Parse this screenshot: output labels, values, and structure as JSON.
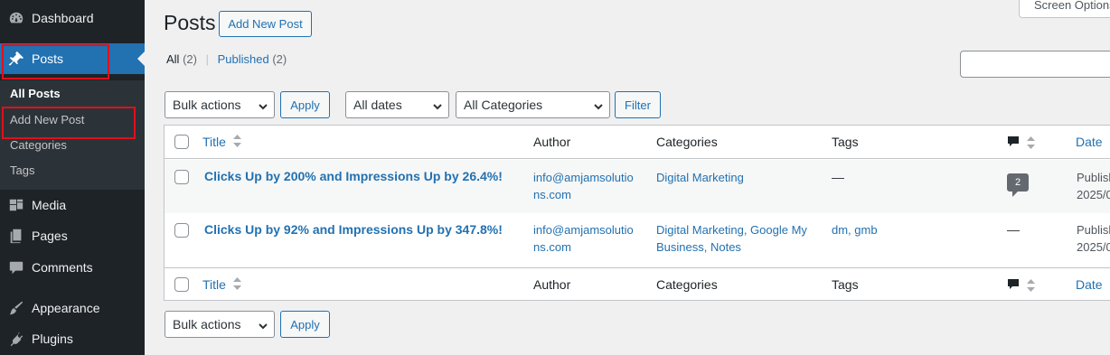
{
  "sidebar": {
    "items": [
      {
        "label": "Dashboard",
        "icon": "dashboard-icon"
      },
      {
        "label": "Posts",
        "icon": "pushpin-icon"
      },
      {
        "label": "Media",
        "icon": "media-icon"
      },
      {
        "label": "Pages",
        "icon": "pages-icon"
      },
      {
        "label": "Comments",
        "icon": "comments-icon"
      },
      {
        "label": "Appearance",
        "icon": "appearance-icon"
      },
      {
        "label": "Plugins",
        "icon": "plugins-icon"
      }
    ],
    "submenu": [
      "All Posts",
      "Add New Post",
      "Categories",
      "Tags"
    ]
  },
  "header": {
    "title": "Posts",
    "add_new_label": "Add New Post",
    "screen_options": "Screen Options"
  },
  "views": {
    "all_label": "All",
    "all_count": "(2)",
    "separator": "|",
    "published_label": "Published",
    "published_count": "(2)"
  },
  "filters": {
    "bulk_actions": "Bulk actions",
    "apply": "Apply",
    "dates": "All dates",
    "categories": "All Categories",
    "filter": "Filter"
  },
  "table": {
    "columns": {
      "title": "Title",
      "author": "Author",
      "categories": "Categories",
      "tags": "Tags",
      "date": "Date"
    },
    "rows": [
      {
        "title": "Clicks Up by 200% and Impressions Up by 26.4%!",
        "author_line1": "info@amjamsolutio",
        "author_line2": "ns.com",
        "categories_line1": "Digital Marketing",
        "categories_line2": "",
        "tags": "—",
        "comments": "2",
        "date_line1": "Publish",
        "date_line2": "2025/0"
      },
      {
        "title": "Clicks Up by 92% and Impressions Up by 347.8%!",
        "author_line1": "info@amjamsolutio",
        "author_line2": "ns.com",
        "categories_line1": "Digital Marketing, Google My",
        "categories_line2": "Business, Notes",
        "tags": "dm, gmb",
        "comments": "—",
        "date_line1": "Publish",
        "date_line2": "2025/0"
      }
    ]
  },
  "colors": {
    "sidebar_bg": "#1d2327",
    "accent": "#2271b1",
    "highlight_box": "#e0101a"
  }
}
